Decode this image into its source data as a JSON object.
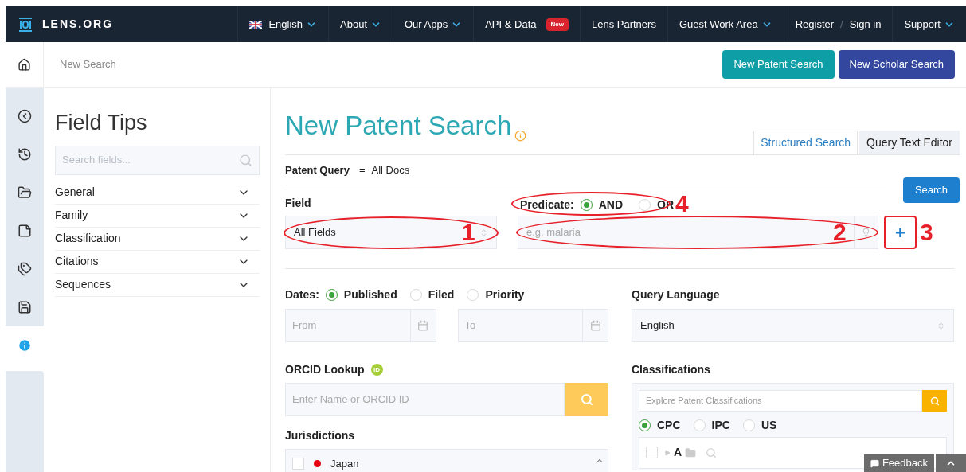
{
  "navbar": {
    "logo": "LENS.ORG",
    "items": [
      {
        "kind": "language",
        "label": "English",
        "dropdown": true
      },
      {
        "kind": "link",
        "label": "About",
        "dropdown": true
      },
      {
        "kind": "link",
        "label": "Our Apps",
        "dropdown": true
      },
      {
        "kind": "link",
        "label": "API & Data",
        "dropdown": false,
        "badge": "New"
      },
      {
        "kind": "link",
        "label": "Lens Partners",
        "dropdown": false
      },
      {
        "kind": "link",
        "label": "Guest Work Area",
        "dropdown": true
      },
      {
        "kind": "auth",
        "label": "Register",
        "separator": "/",
        "label2": "Sign in"
      },
      {
        "kind": "link",
        "label": "Support",
        "dropdown": true
      }
    ]
  },
  "breadcrumb": {
    "current": "New Search"
  },
  "header_buttons": [
    {
      "label": "New Patent Search",
      "kind": "patent"
    },
    {
      "label": "New Scholar Search",
      "kind": "scholar"
    }
  ],
  "rail": [
    {
      "kind": "collapse",
      "selected": false
    },
    {
      "kind": "history",
      "selected": false
    },
    {
      "kind": "folder",
      "selected": false
    },
    {
      "kind": "note",
      "selected": false
    },
    {
      "kind": "tags",
      "selected": false
    },
    {
      "kind": "save",
      "selected": false
    },
    {
      "kind": "info",
      "selected": true
    }
  ],
  "field_tips": {
    "title": "Field Tips",
    "search_placeholder": "Search fields...",
    "sections": [
      {
        "label": "General",
        "expanded": false
      },
      {
        "label": "Family",
        "expanded": false
      },
      {
        "label": "Classification",
        "expanded": false
      },
      {
        "label": "Citations",
        "expanded": false
      },
      {
        "label": "Sequences",
        "expanded": false
      }
    ]
  },
  "main": {
    "title": "New Patent Search",
    "tabs": [
      {
        "label": "Structured Search",
        "selected": true
      },
      {
        "label": "Query Text Editor",
        "selected": false
      }
    ],
    "query_label": "Patent Query",
    "query_eq": "=",
    "query_value": "All Docs",
    "search_button": "Search",
    "field_label": "Field",
    "field_value": "All Fields",
    "predicate_label": "Predicate:",
    "predicate_options": [
      {
        "label": "AND",
        "selected": true
      },
      {
        "label": "OR",
        "selected": false
      }
    ],
    "query_placeholder": "e.g. malaria",
    "add_button": "+",
    "annotations": [
      "1",
      "2",
      "3",
      "4"
    ],
    "dates_label": "Dates:",
    "date_options": [
      {
        "label": "Published",
        "selected": true
      },
      {
        "label": "Filed",
        "selected": false
      },
      {
        "label": "Priority",
        "selected": false
      }
    ],
    "from_placeholder": "From",
    "to_placeholder": "To",
    "query_language_label": "Query Language",
    "query_language_value": "English",
    "orcid_label": "ORCID Lookup",
    "orcid_badge": "iD",
    "orcid_placeholder": "Enter Name or ORCID ID",
    "jurisdictions_label": "Jurisdictions",
    "jurisdictions": [
      {
        "label": "Japan",
        "checked": false,
        "color": "#e60012"
      }
    ],
    "classifications_label": "Classifications",
    "classifications_placeholder": "Explore Patent Classifications",
    "schemes": [
      {
        "label": "CPC",
        "selected": true
      },
      {
        "label": "IPC",
        "selected": false
      },
      {
        "label": "US",
        "selected": false
      }
    ],
    "tree": [
      {
        "label": "A",
        "checked": false,
        "expanded": false
      }
    ]
  },
  "feedback": {
    "label": "Feedback"
  }
}
